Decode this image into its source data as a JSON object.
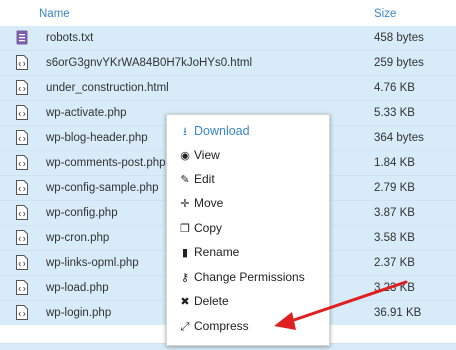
{
  "header": {
    "name_label": "Name",
    "size_label": "Size"
  },
  "files": [
    {
      "name": "robots.txt",
      "size": "458 bytes",
      "icon": "text-file-icon"
    },
    {
      "name": "s6orG3gnvYKrWA84B0H7kJoHYs0.html",
      "size": "259 bytes",
      "icon": "code-file-icon"
    },
    {
      "name": "under_construction.html",
      "size": "4.76 KB",
      "icon": "code-file-icon"
    },
    {
      "name": "wp-activate.php",
      "size": "5.33 KB",
      "icon": "code-file-icon"
    },
    {
      "name": "wp-blog-header.php",
      "size": "364 bytes",
      "icon": "code-file-icon"
    },
    {
      "name": "wp-comments-post.php",
      "size": "1.84 KB",
      "icon": "code-file-icon"
    },
    {
      "name": "wp-config-sample.php",
      "size": "2.79 KB",
      "icon": "code-file-icon"
    },
    {
      "name": "wp-config.php",
      "size": "3.87 KB",
      "icon": "code-file-icon"
    },
    {
      "name": "wp-cron.php",
      "size": "3.58 KB",
      "icon": "code-file-icon"
    },
    {
      "name": "wp-links-opml.php",
      "size": "2.37 KB",
      "icon": "code-file-icon"
    },
    {
      "name": "wp-load.php",
      "size": "3.23 KB",
      "icon": "code-file-icon"
    },
    {
      "name": "wp-login.php",
      "size": "36.91 KB",
      "icon": "code-file-icon"
    }
  ],
  "context_menu": {
    "items": [
      {
        "label": "Download",
        "icon": "download-icon"
      },
      {
        "label": "View",
        "icon": "eye-icon"
      },
      {
        "label": "Edit",
        "icon": "pencil-icon"
      },
      {
        "label": "Move",
        "icon": "move-icon"
      },
      {
        "label": "Copy",
        "icon": "copy-icon"
      },
      {
        "label": "Rename",
        "icon": "file-icon"
      },
      {
        "label": "Change Permissions",
        "icon": "key-icon"
      },
      {
        "label": "Delete",
        "icon": "close-icon"
      },
      {
        "label": "Compress",
        "icon": "compress-icon"
      }
    ]
  },
  "colors": {
    "accent": "#3a87c8",
    "row_bg": "#d7ebf9",
    "arrow": "#e02020"
  }
}
